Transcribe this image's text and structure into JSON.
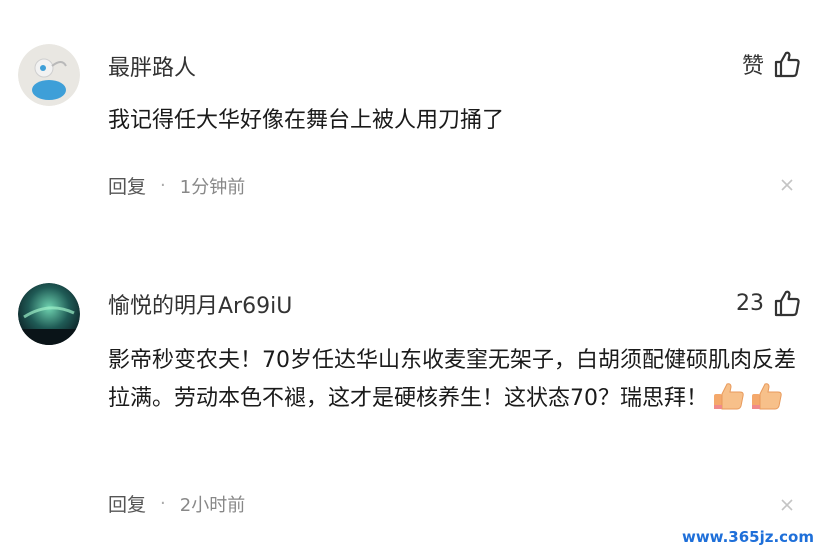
{
  "comments": [
    {
      "username": "最胖路人",
      "like_label": "赞",
      "text": "我记得任大华好像在舞台上被人用刀捅了",
      "reply_label": "回复",
      "separator": "·",
      "time": "1分钟前"
    },
    {
      "username": "愉悦的明月Ar69iU",
      "like_label": "23",
      "text": "影帝秒变农夫！70岁任达华山东收麦窐无架子，白胡须配健硕肌肉反差拉满。劳动本色不褪，这才是硬核养生！这状态70？瑞思拜！",
      "reply_label": "回复",
      "separator": "·",
      "time": "2小时前"
    }
  ],
  "watermark": "www.365jz.com",
  "icons": {
    "like": "thumbs-up-icon",
    "close": "close-icon",
    "emoji": "thumbs-up-emoji"
  },
  "colors": {
    "meta": "#888888",
    "watermark": "#1e6fd9"
  }
}
